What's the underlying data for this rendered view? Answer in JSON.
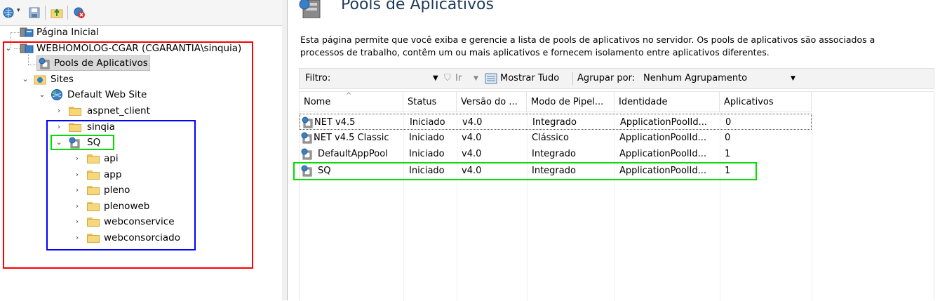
{
  "colors": {
    "highlight_red": "#ff0000",
    "highlight_blue": "#0000ff",
    "highlight_green": "#00dd00",
    "title": "#1e395b"
  },
  "toolbar": {
    "icons": [
      "globe-dropdown-icon",
      "save-icon",
      "up-folder-icon",
      "disconnect-icon"
    ]
  },
  "tree": {
    "home": "Página Inicial",
    "server": "WEBHOMOLOG-CGAR (CGARANTIA\\sinquia)",
    "app_pools": "Pools de Aplicativos",
    "sites": "Sites",
    "default_site": "Default Web Site",
    "aspnet_client": "aspnet_client",
    "sinqia": "sinqia",
    "sq": "SQ",
    "sq_children": [
      "api",
      "app",
      "pleno",
      "plenoweb",
      "webconservice",
      "webconsorciado"
    ]
  },
  "main": {
    "title": "Pools de Aplicativos",
    "description": "Esta página permite que você exiba e gerencie a lista de pools de aplicativos no servidor. Os pools de aplicativos são associados a processos de trabalho, contêm um ou mais aplicativos e fornecem isolamento entre aplicativos diferentes.",
    "filter": {
      "label": "Filtro:",
      "value": "",
      "go_label": "Ir",
      "show_all_label": "Mostrar Tudo",
      "group_by_label": "Agrupar por:",
      "group_by_value": "Nenhum Agrupamento"
    },
    "columns": [
      "Nome",
      "Status",
      "Versão do ...",
      "Modo de Pipel...",
      "Identidade",
      "Aplicativos"
    ],
    "rows": [
      [
        "NET v4.5",
        "Iniciado",
        "v4.0",
        "Integrado",
        "ApplicationPoolId...",
        "0"
      ],
      [
        "NET v4.5 Classic",
        "Iniciado",
        "v4.0",
        "Clássico",
        "ApplicationPoolId...",
        "0"
      ],
      [
        "DefaultAppPool",
        "Iniciado",
        "v4.0",
        "Integrado",
        "ApplicationPoolId...",
        "1"
      ],
      [
        "SQ",
        "Iniciado",
        "v4.0",
        "Integrado",
        "ApplicationPoolId...",
        "1"
      ]
    ]
  }
}
